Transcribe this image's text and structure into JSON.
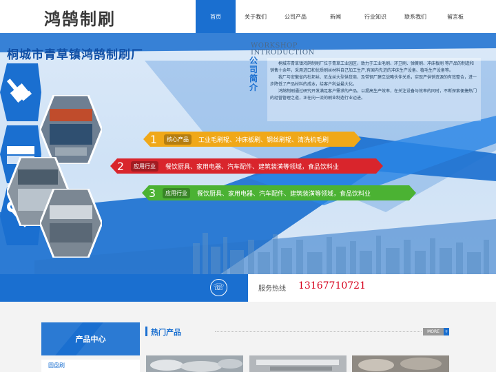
{
  "header": {
    "logo": "鸿鹄制刷",
    "nav": [
      "首页",
      "关于我们",
      "公司产品",
      "新闻",
      "行业知识",
      "联系我们",
      "留言板"
    ],
    "active_index": 0
  },
  "banner": {
    "company_name": "桐城市青草镇鸿鹄制刷厂",
    "intro_heading_en_1": "WORKSHOP",
    "intro_heading_en_2": "INTRODUCTION",
    "intro_heading_cn": "公司简介",
    "intro_paragraphs": [
      "桐城市青草镇鸿鹄制刷厂位于青草工业园区，致力于工业毛刷、环卫刷、弹簧刷、冲床板刷 等产品的制造和销售十余年，采用进口和优质刷丝材料自己加工生产,有国内先进的冲床生产设备、植毛生产设备等。",
      "我厂与安徽省内杜邦丝、尼龙丝大型供货商、及带钢厂建立战略伙伴关系，实现产供销资源的有效整合，进一步降低了产品材料的成本，给客户利益最大化。",
      "鸿鹄制刷通过研究开发满足客户需求的产品，以提高生产效率，在关注设备与效率的同时，不断探索便捷热门的经营管理之道，正在向一流的刷业制造行业迈进。"
    ],
    "bars": [
      {
        "num": "1",
        "tag": "核心产品",
        "text": "工业毛刷辊、冲床板刷、钢丝刷辊、清洗机毛刷",
        "color": "#f0a818"
      },
      {
        "num": "2",
        "tag": "应用行业",
        "text": "餐饮厨具、家用电器、汽车配件、建筑装潢等领域，食品饮料业",
        "color": "#d9252c"
      },
      {
        "num": "3",
        "tag": "应用行业",
        "text": "餐饮厨具、家用电器、汽车配件、建筑装潢等领域，食品饮料业",
        "color": "#4bb233"
      }
    ],
    "icons": [
      "paint-brush-icon",
      "broom-brush-icon",
      "wrench-icon"
    ]
  },
  "hotline": {
    "label": "服务热线",
    "number": "13167710721",
    "icon": "phone-icon"
  },
  "content": {
    "product_center_title": "产品中心",
    "categories": [
      "圆盘刷"
    ],
    "hot_products_title": "热门产品",
    "more_label": "MORE",
    "more_arrow": "+"
  },
  "colors": {
    "primary": "#1a6fd0",
    "accent_red": "#d6001c"
  }
}
